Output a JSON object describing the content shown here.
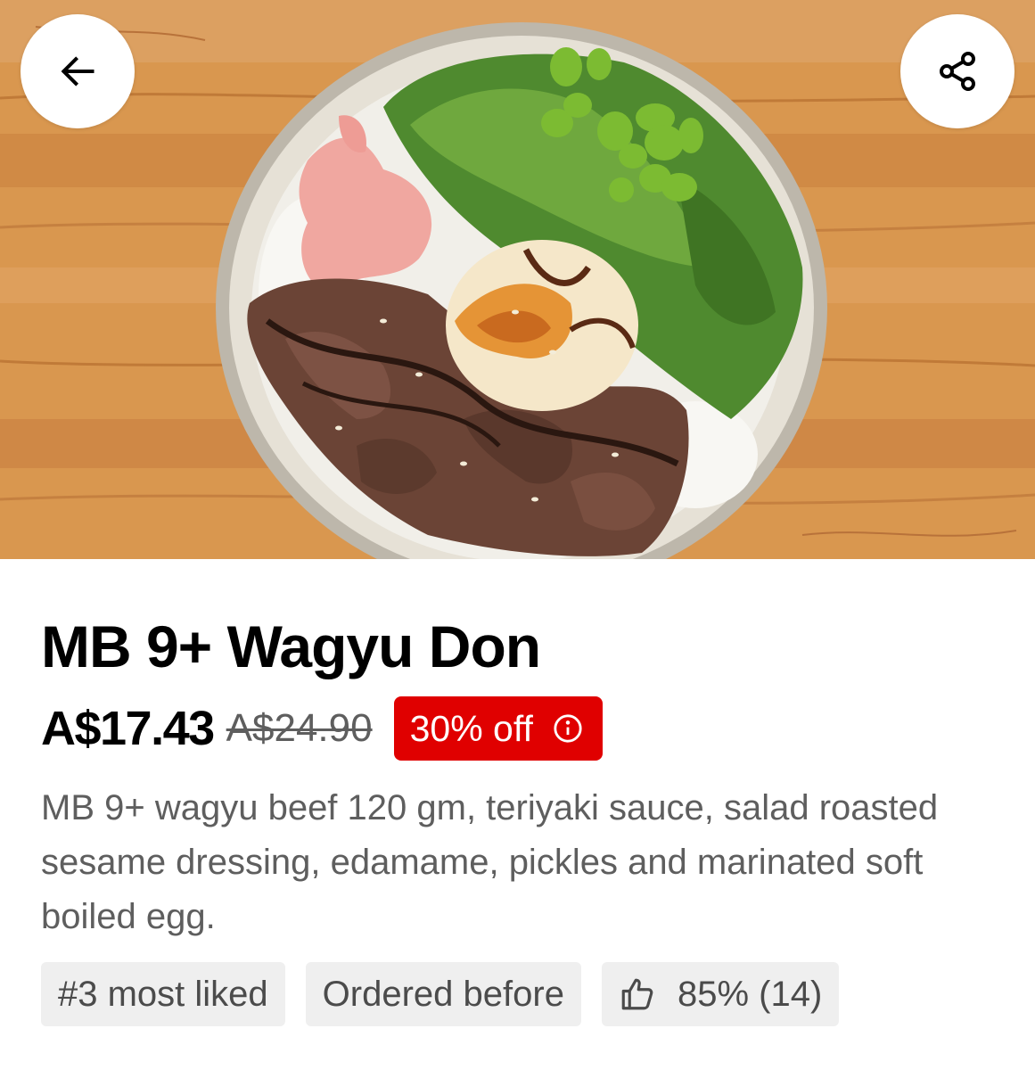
{
  "app": {
    "accent_color": "#e00000"
  },
  "header": {
    "back_icon": "arrow-left-icon",
    "share_icon": "share-icon",
    "image_subject": "wagyu-don-bowl"
  },
  "item": {
    "title": "MB 9+ Wagyu Don",
    "price": "A$17.43",
    "original_price": "A$24.90",
    "discount_label": "30% off",
    "discount_icon": "info-icon",
    "description": "MB 9+ wagyu beef 120 gm, teriyaki sauce, salad roasted sesame dressing, edamame, pickles and marinated soft boiled egg."
  },
  "tags": [
    {
      "label": "#3 most liked"
    },
    {
      "label": "Ordered before"
    },
    {
      "label": "85% (14)",
      "icon": "thumbs-up-icon"
    }
  ]
}
